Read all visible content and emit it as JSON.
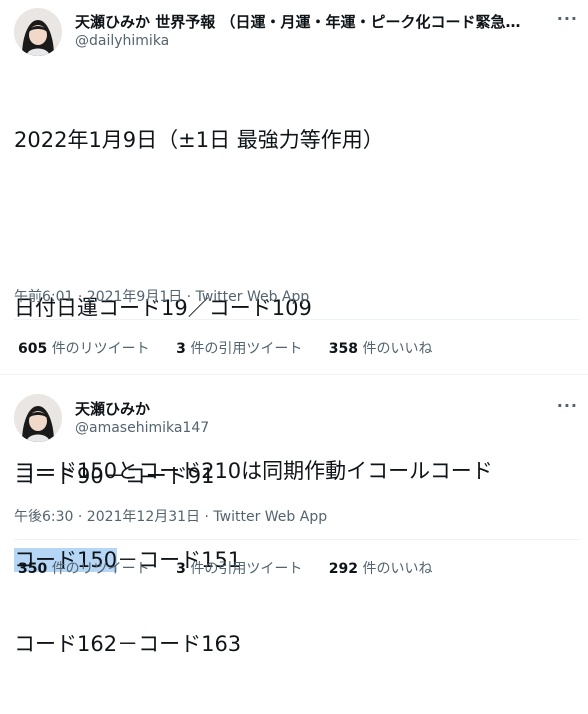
{
  "tweet1": {
    "name": "天瀬ひみか 世界予報 （日運・月運・年運・ピーク化コード緊急警...",
    "handle": "@dailyhimika",
    "more": "···",
    "lines": [
      "2022年1月9日（±1日 最強力等作用）",
      "",
      "日付日運コード19／コード109",
      "",
      "コード90－コード91"
    ],
    "line6_highlight": "コード150",
    "line6_rest": "－コード151",
    "line7": "コード162－コード163",
    "meta": "午前6:01 · 2021年9月1日 · Twitter Web App",
    "retweets_count": "605",
    "retweets_label": "件のリツイート",
    "quotes_count": "3",
    "quotes_label": "件の引用ツイート",
    "likes_count": "358",
    "likes_label": "件のいいね"
  },
  "tweet2": {
    "name": "天瀬ひみか",
    "handle": "@amasehimika147",
    "more": "···",
    "text": "コード150とコード210は同期作動イコールコード",
    "meta": "午後6:30 · 2021年12月31日 · Twitter Web App",
    "retweets_count": "350",
    "retweets_label": "件のリツイート",
    "quotes_count": "3",
    "quotes_label": "件の引用ツイート",
    "likes_count": "292",
    "likes_label": "件のいいね"
  }
}
